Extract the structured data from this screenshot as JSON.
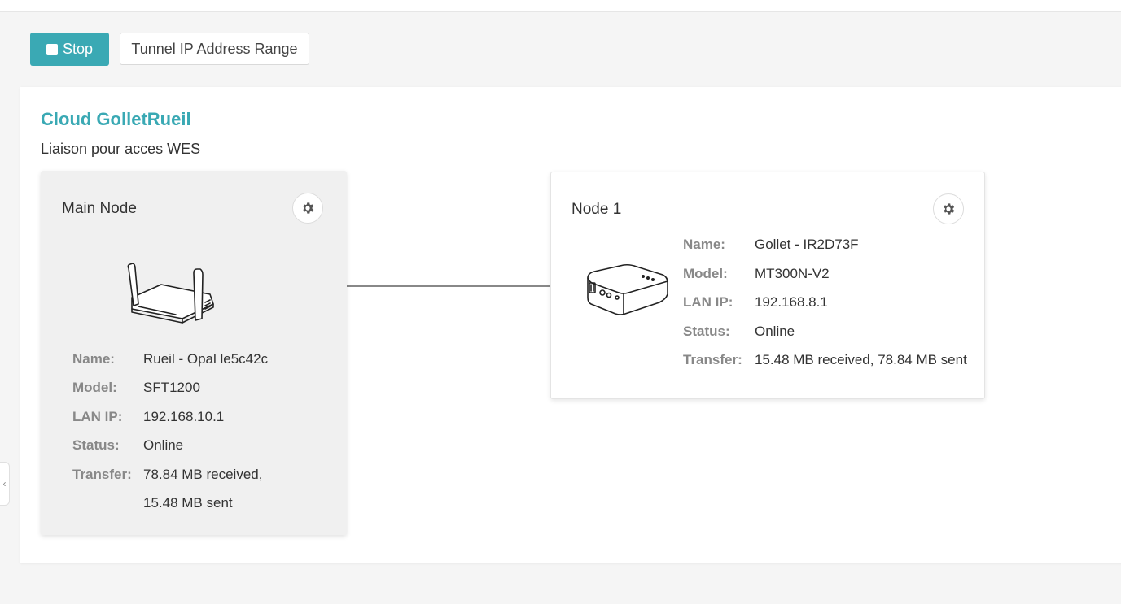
{
  "toolbar": {
    "stop_label": "Stop",
    "range_label": "Tunnel IP Address Range"
  },
  "cloud": {
    "title": "Cloud GolletRueil",
    "description": "Liaison pour acces WES"
  },
  "labels": {
    "name": "Name:",
    "model": "Model:",
    "lan_ip": "LAN IP:",
    "status": "Status:",
    "transfer": "Transfer:"
  },
  "main_node": {
    "title": "Main Node",
    "name": "Rueil - Opal le5c42c",
    "model": "SFT1200",
    "lan_ip": "192.168.10.1",
    "status": "Online",
    "transfer_line1": "78.84 MB received,",
    "transfer_line2": "15.48 MB sent"
  },
  "node1": {
    "title": "Node 1",
    "name": "Gollet - IR2D73F",
    "model": "MT300N-V2",
    "lan_ip": "192.168.8.1",
    "status": "Online",
    "transfer": "15.48 MB received, 78.84 MB sent"
  },
  "icons": {
    "stop": "stop-square-icon",
    "gear": "gear-icon",
    "router_main": "router-antenna-icon",
    "router_node1": "travel-router-icon",
    "collapse": "chevron-left-icon"
  },
  "colors": {
    "accent": "#3aa9b4"
  }
}
